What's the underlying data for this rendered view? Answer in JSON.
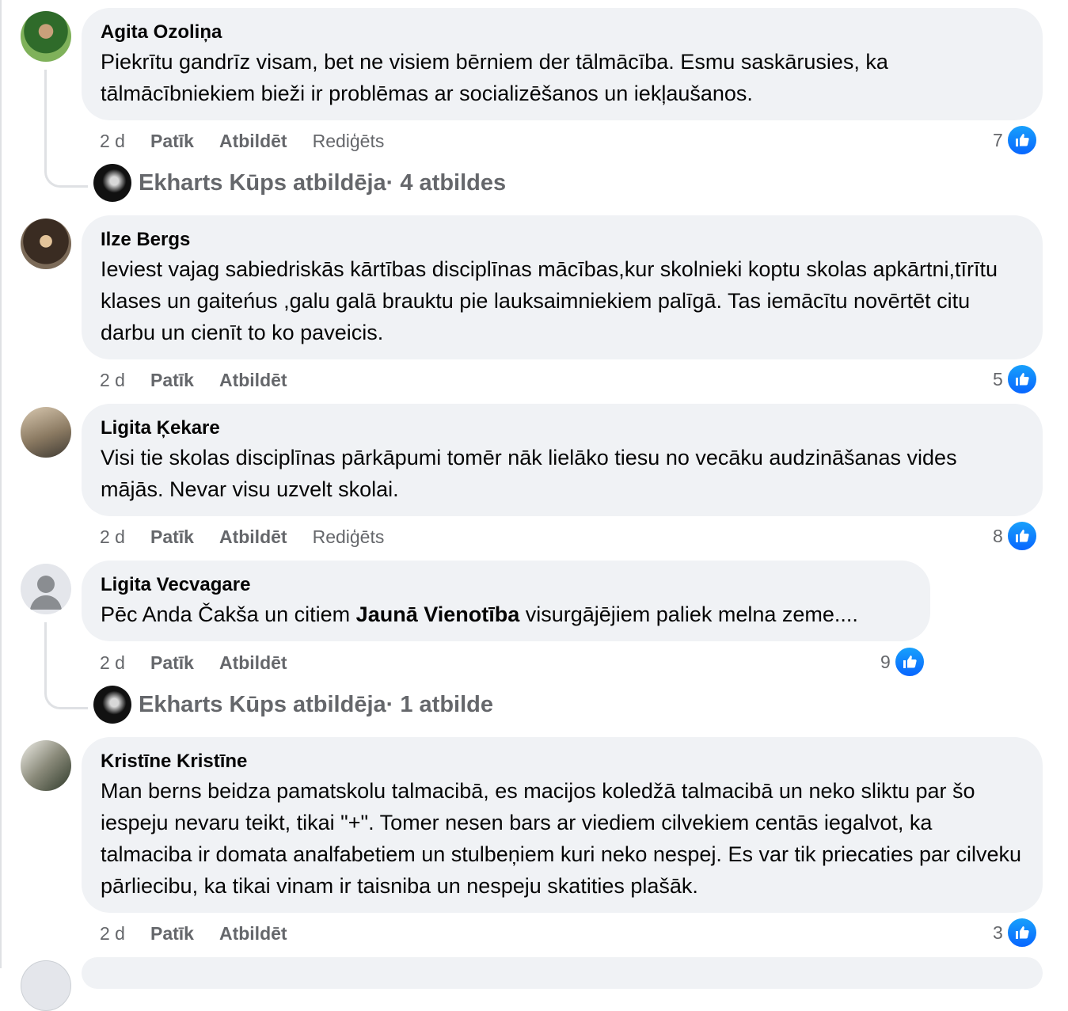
{
  "comments": [
    {
      "author": "Agita Ozoliņa",
      "text": "Piekrītu gandrīz visam, bet ne visiem bērniem der tālmācība. Esmu saskārusies, ka tālmācībniekiem bieži ir problēmas ar socializēšanos un iekļaušanos.",
      "time": "2 d",
      "like": "Patīk",
      "reply": "Atbildēt",
      "edited": "Rediģēts",
      "reactions": "7",
      "replies_summary": {
        "author": "Ekharts Kūps atbildēja",
        "count": " · 4 atbildes"
      }
    },
    {
      "author": "Ilze Bergs",
      "text": "Ieviest vajag sabiedriskās kārtības disciplīnas mācības,kur skolnieki koptu skolas apkārtni,tīrītu klases un gaiteńus ,galu galā brauktu pie lauksaimniekiem palīgā. Tas iemācītu novērtēt citu darbu un cienīt to ko paveicis.",
      "time": "2 d",
      "like": "Patīk",
      "reply": "Atbildēt",
      "reactions": "5"
    },
    {
      "author": "Ligita Ķekare",
      "text": "Visi tie skolas disciplīnas pārkāpumi tomēr nāk lielāko tiesu no vecāku audzināšanas vides mājās. Nevar visu uzvelt skolai.",
      "time": "2 d",
      "like": "Patīk",
      "reply": "Atbildēt",
      "edited": "Rediģēts",
      "reactions": "8"
    },
    {
      "author": "Ligita Vecvagare",
      "text_before": "Pēc Anda Čakša un citiem ",
      "text_bold": "Jaunā Vienotība",
      "text_after": " visurgājējiem paliek melna zeme....",
      "time": "2 d",
      "like": "Patīk",
      "reply": "Atbildēt",
      "reactions": "9",
      "replies_summary": {
        "author": "Ekharts Kūps atbildēja",
        "count": " · 1 atbilde"
      }
    },
    {
      "author": "Kristīne Kristīne",
      "text": "Man berns beidza pamatskolu talmacibā, es macijos koledžā talmacibā un neko sliktu par šo iespeju nevaru teikt, tikai \"+\". Tomer nesen bars ar viediem cilvekiem centās iegalvot, ka talmaciba ir domata analfabetiem un stulbeņiem kuri neko nespej. Es var tik priecaties par cilveku pārliecibu, ka tikai vinam ir taisniba un nespeju skatities plašāk.",
      "time": "2 d",
      "like": "Patīk",
      "reply": "Atbildēt",
      "reactions": "3"
    }
  ],
  "colors": {
    "bubble": "#f0f2f5",
    "meta": "#65676b",
    "like_blue": "#0866ff"
  }
}
